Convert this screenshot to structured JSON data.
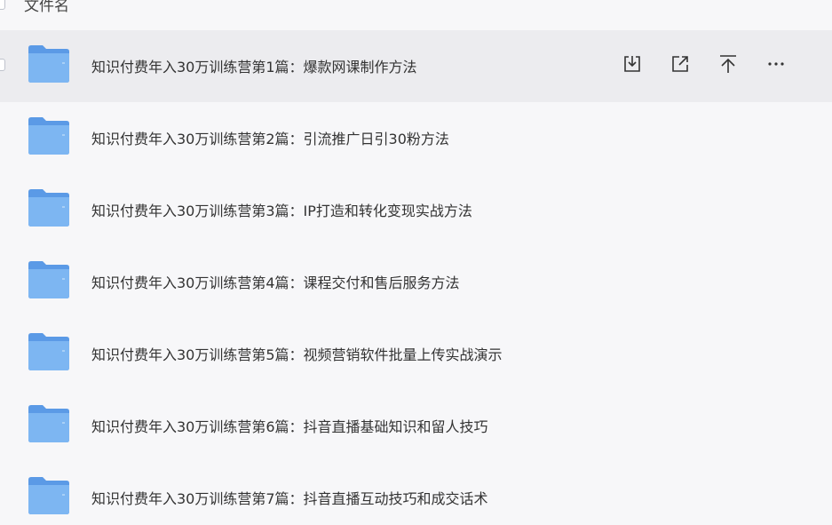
{
  "header": {
    "column_name_label": "文件名"
  },
  "files": [
    {
      "name": "知识付费年入30万训练营第1篇：爆款网课制作方法",
      "selected": true,
      "icon": "folder-icon"
    },
    {
      "name": "知识付费年入30万训练营第2篇：引流推广日引30粉方法",
      "selected": false,
      "icon": "folder-icon"
    },
    {
      "name": "知识付费年入30万训练营第3篇：IP打造和转化变现实战方法",
      "selected": false,
      "icon": "folder-icon"
    },
    {
      "name": "知识付费年入30万训练营第4篇：课程交付和售后服务方法",
      "selected": false,
      "icon": "folder-icon"
    },
    {
      "name": "知识付费年入30万训练营第5篇：视频营销软件批量上传实战演示",
      "selected": false,
      "icon": "folder-icon"
    },
    {
      "name": "知识付费年入30万训练营第6篇：抖音直播基础知识和留人技巧",
      "selected": false,
      "icon": "folder-icon"
    },
    {
      "name": "知识付费年入30万训练营第7篇：抖音直播互动技巧和成交话术",
      "selected": false,
      "icon": "folder-icon"
    }
  ],
  "row_actions": [
    "download-icon",
    "share-icon",
    "move-to-top-icon",
    "more-icon"
  ],
  "colors": {
    "background": "#f7f7f9",
    "selected_row": "#ececef",
    "folder_blue": "#6aa8ef"
  }
}
